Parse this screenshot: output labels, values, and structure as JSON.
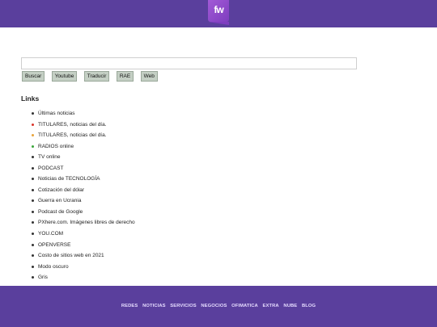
{
  "header": {
    "logo_text": "fw",
    "logo_icon": "fw-logo"
  },
  "search": {
    "value": "",
    "placeholder": ""
  },
  "buttons": [
    "Buscar",
    "Youtube",
    "Traducir",
    "RAE",
    "Web"
  ],
  "links_title": "Links",
  "links": [
    {
      "label": "Últimas noticias",
      "bullet": "#333333"
    },
    {
      "label": "TITULARES, noticias del día.",
      "bullet": "#d9342b"
    },
    {
      "label": "TITULARES, noticias del día.",
      "bullet": "#e8a33a"
    },
    {
      "label": "RADIOS online",
      "bullet": "#3aa63a"
    },
    {
      "label": "TV online",
      "bullet": "#333333"
    },
    {
      "label": "PODCAST",
      "bullet": "#333333"
    },
    {
      "label": "Noticias de TECNOLOGÍA",
      "bullet": "#333333"
    },
    {
      "label": "Cotización del dólar",
      "bullet": "#333333"
    },
    {
      "label": "Guerra en Ucrania",
      "bullet": "#333333"
    },
    {
      "label": "Podcast de Google",
      "bullet": "#333333"
    },
    {
      "label": "PXhere.com. Imágenes libres de derecho",
      "bullet": "#333333"
    },
    {
      "label": "YOU.COM",
      "bullet": "#333333"
    },
    {
      "label": "OPENVERSE",
      "bullet": "#333333"
    },
    {
      "label": "Costo de sitios web en 2021",
      "bullet": "#333333"
    },
    {
      "label": "Modo oscuro",
      "bullet": "#333333"
    },
    {
      "label": "Gris",
      "bullet": "#333333"
    }
  ],
  "footer": [
    "REDES",
    "NOTICIAS",
    "SERVICIOS",
    "NEGOCIOS",
    "OFIMATICA",
    "EXTRA",
    "NUBE",
    "BLOG"
  ],
  "colors": {
    "brand_purple": "#5a3f9d",
    "button_bg": "#c4cfc4",
    "footer_text": "#e6dcff"
  }
}
